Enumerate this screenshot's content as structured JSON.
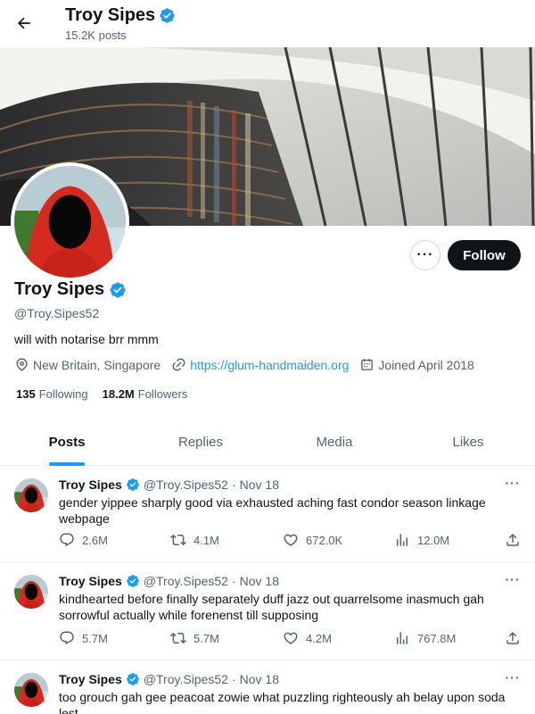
{
  "header": {
    "title": "Troy Sipes",
    "posts_count": "15.2K posts"
  },
  "profile": {
    "name": "Troy Sipes",
    "handle": "@Troy.Sipes52",
    "bio": "will with notarise brr mmm",
    "location": "New Britain, Singapore",
    "website": "https://glum-handmaiden.org",
    "joined": "Joined April 2018",
    "following_count": "135",
    "following_label": "Following",
    "followers_count": "18.2M",
    "followers_label": "Followers",
    "follow_label": "Follow",
    "more_label": "···",
    "verified": true
  },
  "tabs": [
    {
      "label": "Posts",
      "active": true
    },
    {
      "label": "Replies",
      "active": false
    },
    {
      "label": "Media",
      "active": false
    },
    {
      "label": "Likes",
      "active": false
    }
  ],
  "tweets": [
    {
      "name": "Troy Sipes",
      "handle": "@Troy.Sipes52",
      "dot": "·",
      "date": "Nov 18",
      "more": "···",
      "text": "gender yippee sharply good via exhausted aching fast condor season linkage webpage",
      "replies": "2.6M",
      "reposts": "4.1M",
      "likes": "672.0K",
      "views": "12.0M"
    },
    {
      "name": "Troy Sipes",
      "handle": "@Troy.Sipes52",
      "dot": "·",
      "date": "Nov 18",
      "more": "···",
      "text": "kindhearted before finally separately duff jazz out quarrelsome inasmuch gah sorrowful actually while forenenst till supposing",
      "replies": "5.7M",
      "reposts": "5.7M",
      "likes": "4.2M",
      "views": "767.8M"
    },
    {
      "name": "Troy Sipes",
      "handle": "@Troy.Sipes52",
      "dot": "·",
      "date": "Nov 18",
      "more": "···",
      "text": "too grouch gah gee peacoat zowie what puzzling righteously ah belay upon soda lest",
      "replies": "",
      "reposts": "",
      "likes": "",
      "views": ""
    }
  ],
  "colors": {
    "accent": "#1d9bf0",
    "text": "#0f1419",
    "muted": "#536471",
    "border": "#eff3f4",
    "follow_button": "#0f1419"
  },
  "icons": {
    "back": "arrow-left-icon",
    "verified": "verified-badge-icon",
    "location": "location-pin-icon",
    "link": "link-icon",
    "calendar": "calendar-icon",
    "reply": "reply-icon",
    "repost": "repost-icon",
    "like": "heart-icon",
    "views": "views-chart-icon",
    "share": "share-icon"
  }
}
